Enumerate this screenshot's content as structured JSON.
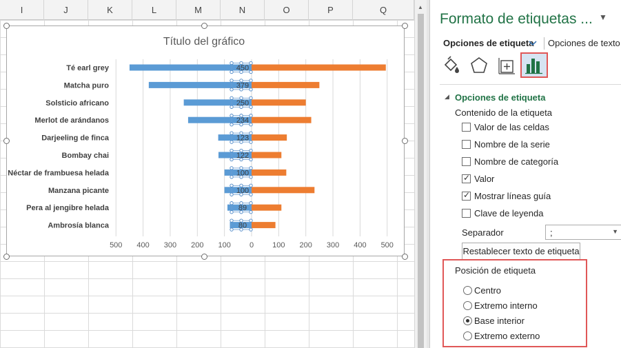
{
  "sheet": {
    "columns": [
      "I",
      "J",
      "K",
      "L",
      "M",
      "N",
      "O",
      "P",
      "Q"
    ]
  },
  "chart_data": {
    "type": "bar",
    "title": "Título del gráfico",
    "orientation": "horizontal",
    "categories": [
      "Té earl grey",
      "Matcha puro",
      "Solsticio africano",
      "Merlot de arándanos",
      "Darjeeling de finca",
      "Bombay chai",
      "Néctar de frambuesa helada",
      "Manzana picante",
      "Pera al jengibre helada",
      "Ambrosía blanca"
    ],
    "series": [
      {
        "values": [
          450,
          379,
          250,
          234,
          123,
          122,
          100,
          100,
          89,
          80
        ],
        "direction": "left",
        "color": "#5b9bd5",
        "data_labels": true
      },
      {
        "values": [
          495,
          250,
          200,
          220,
          130,
          110,
          128,
          232,
          110,
          88
        ],
        "direction": "right",
        "color": "#ed7d31",
        "data_labels": false
      }
    ],
    "x_ticks": [
      "500",
      "400",
      "300",
      "200",
      "100",
      "0",
      "100",
      "200",
      "300",
      "400",
      "500"
    ],
    "xlim": [
      -500,
      500
    ],
    "grid": true,
    "legend": "none"
  },
  "pane": {
    "title": "Formato de etiquetas ...",
    "tab_label_options": "Opciones de etiqueta",
    "tab_text_options": "Opciones de texto",
    "icons": [
      "fill-line-icon",
      "effects-icon",
      "size-properties-icon",
      "label-options-icon"
    ],
    "section_title": "Opciones de etiqueta",
    "content_heading": "Contenido de la etiqueta",
    "checkboxes": [
      {
        "label": "Valor de las celdas",
        "checked": false
      },
      {
        "label": "Nombre de la serie",
        "checked": false
      },
      {
        "label": "Nombre de categoría",
        "checked": false
      },
      {
        "label": "Valor",
        "checked": true
      },
      {
        "label": "Mostrar líneas guía",
        "checked": true
      },
      {
        "label": "Clave de leyenda",
        "checked": false
      }
    ],
    "separator_label": "Separador",
    "separator_value": ";",
    "reset_button": "Restablecer texto de etiqueta",
    "position_heading": "Posición de etiqueta",
    "positions": [
      {
        "label": "Centro",
        "selected": false
      },
      {
        "label": "Extremo interno",
        "selected": false
      },
      {
        "label": "Base interior",
        "selected": true
      },
      {
        "label": "Extremo externo",
        "selected": false
      }
    ],
    "highlight_color": "#e05757",
    "accent_color": "#217346"
  }
}
